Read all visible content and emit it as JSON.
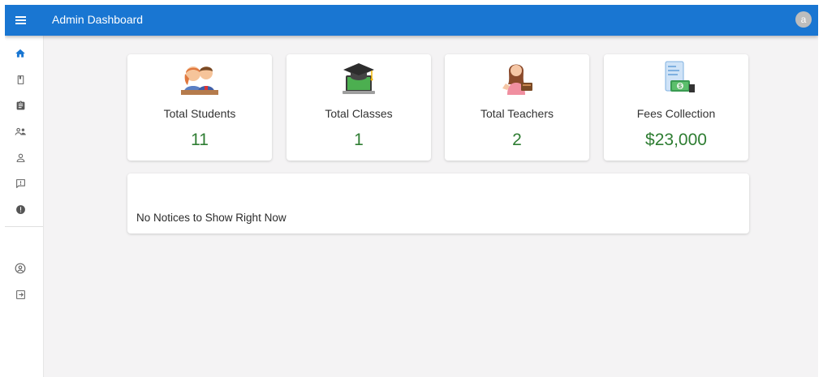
{
  "appbar": {
    "title": "Admin Dashboard",
    "avatar_letter": "a",
    "color": "#1976d2"
  },
  "sidebar": {
    "items": [
      {
        "icon": "home-icon",
        "active": true
      },
      {
        "icon": "class-icon"
      },
      {
        "icon": "subjects-icon"
      },
      {
        "icon": "teachers-icon"
      },
      {
        "icon": "students-icon"
      },
      {
        "icon": "notices-icon"
      },
      {
        "icon": "complaints-icon"
      }
    ],
    "bottom_items": [
      {
        "icon": "profile-icon"
      },
      {
        "icon": "logout-icon"
      }
    ]
  },
  "stats": [
    {
      "label": "Total Students",
      "value": "11",
      "icon": "students-illustration"
    },
    {
      "label": "Total Classes",
      "value": "1",
      "icon": "classes-illustration"
    },
    {
      "label": "Total Teachers",
      "value": "2",
      "icon": "teachers-illustration"
    },
    {
      "label": "Fees Collection",
      "value": "$23,000",
      "icon": "fees-illustration"
    }
  ],
  "notice": {
    "message": "No Notices to Show Right Now"
  },
  "colors": {
    "accent": "#1976d2",
    "value_green": "#2e7d32",
    "background": "#f4f3f4"
  }
}
